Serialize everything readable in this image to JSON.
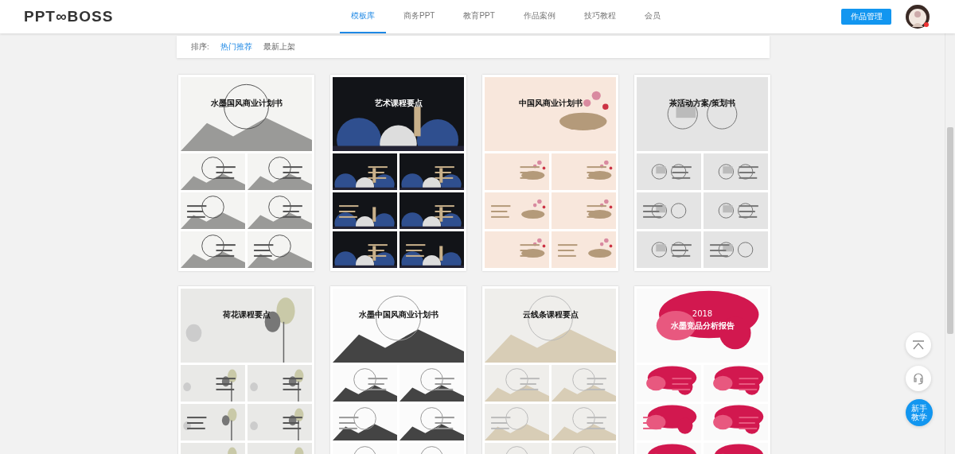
{
  "header": {
    "logo": "PPT∞BOSS",
    "nav": [
      {
        "label": "模板库",
        "selected": true
      },
      {
        "label": "商务PPT",
        "selected": false
      },
      {
        "label": "教育PPT",
        "selected": false
      },
      {
        "label": "作品案例",
        "selected": false
      },
      {
        "label": "技巧教程",
        "selected": false
      },
      {
        "label": "会员",
        "selected": false
      }
    ],
    "action_button": "作品管理"
  },
  "sort_bar": {
    "label": "排序:",
    "options": [
      {
        "label": "热门推荐",
        "selected": true
      },
      {
        "label": "最新上架",
        "selected": false
      }
    ]
  },
  "templates": [
    {
      "kind": "ink",
      "title": "水墨国风商业计划书"
    },
    {
      "kind": "dark",
      "title": "艺术课程要点"
    },
    {
      "kind": "peach",
      "title": "中国风商业计划书"
    },
    {
      "kind": "grey",
      "title": "茶活动方案/策划书"
    },
    {
      "kind": "lotus",
      "title": "荷花课程要点"
    },
    {
      "kind": "mountain",
      "title": "水墨中国风商业计划书"
    },
    {
      "kind": "cloud",
      "title": "云线条课程要点"
    },
    {
      "kind": "red",
      "overline": "2018",
      "title": "水墨竞品分析报告"
    }
  ],
  "float_tools": {
    "tutorial_button": "新手教学"
  }
}
